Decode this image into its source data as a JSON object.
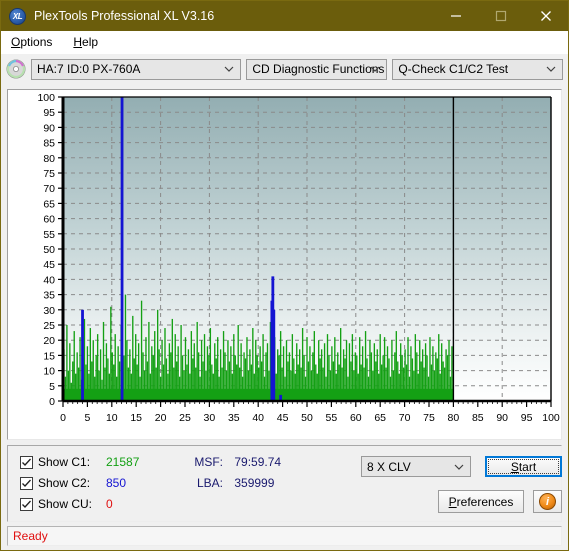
{
  "window": {
    "title": "PlexTools Professional XL V3.16",
    "app_icon": "XL",
    "minimize_label": "Minimize",
    "maximize_label": "Maximize",
    "close_label": "Close"
  },
  "menubar": {
    "items": [
      {
        "label": "Options",
        "accel": "O"
      },
      {
        "label": "Help",
        "accel": "H"
      }
    ]
  },
  "toolbar": {
    "drive_select": "HA:7 ID:0  PX-760A",
    "function_select": "CD Diagnostic Functions",
    "test_select": "Q-Check C1/C2 Test"
  },
  "controls": {
    "show_c1_label": "Show C1:",
    "show_c1_value": "21587",
    "show_c1_checked": true,
    "show_c2_label": "Show C2:",
    "show_c2_value": "850",
    "show_c2_checked": true,
    "show_cu_label": "Show CU:",
    "show_cu_value": "0",
    "show_cu_checked": true,
    "msf_label": "MSF:",
    "msf_value": "79:59.74",
    "lba_label": "LBA:",
    "lba_value": "359999",
    "speed_value": "8 X CLV",
    "start_label": "Start",
    "start_accel": "S",
    "preferences_label": "Preferences",
    "preferences_accel": "P",
    "info_label": "i"
  },
  "statusbar": {
    "text": "Ready"
  },
  "colors": {
    "titlebar": "#6b5d0c",
    "c1_green": "#14a014",
    "c2_blue": "#1414d2",
    "cu_red": "#e01010",
    "status_red": "#e01010",
    "stat_navy": "#1a1a6e",
    "accent_focus": "#0078d7"
  },
  "chart_data": {
    "type": "bar",
    "title": "",
    "xlabel": "",
    "ylabel": "",
    "xlim": [
      0,
      100
    ],
    "ylim": [
      0,
      100
    ],
    "xticks": [
      0,
      5,
      10,
      15,
      20,
      25,
      30,
      35,
      40,
      45,
      50,
      55,
      60,
      65,
      70,
      75,
      80,
      85,
      90,
      95,
      100
    ],
    "yticks": [
      0,
      5,
      10,
      15,
      20,
      25,
      30,
      35,
      40,
      45,
      50,
      55,
      60,
      65,
      70,
      75,
      80,
      85,
      90,
      95,
      100
    ],
    "grid": true,
    "legend": "none",
    "data_end_x": 80,
    "series": [
      {
        "name": "C1",
        "color": "#14a014",
        "x": [
          0.2,
          0.5,
          0.8,
          1.1,
          1.4,
          1.7,
          2.0,
          2.3,
          2.6,
          2.9,
          3.2,
          3.5,
          3.8,
          4.1,
          4.4,
          4.7,
          5.0,
          5.3,
          5.6,
          5.9,
          6.2,
          6.5,
          6.8,
          7.1,
          7.4,
          7.7,
          8.0,
          8.3,
          8.6,
          8.9,
          9.2,
          9.5,
          9.8,
          10.1,
          10.4,
          10.7,
          11.0,
          11.3,
          11.6,
          11.9,
          12.2,
          12.5,
          12.8,
          13.1,
          13.4,
          13.7,
          14.0,
          14.3,
          14.6,
          14.9,
          15.2,
          15.5,
          15.8,
          16.1,
          16.4,
          16.7,
          17.0,
          17.3,
          17.6,
          17.9,
          18.2,
          18.5,
          18.8,
          19.1,
          19.4,
          19.7,
          20.0,
          20.3,
          20.6,
          20.9,
          21.2,
          21.5,
          21.8,
          22.1,
          22.4,
          22.7,
          23.0,
          23.3,
          23.6,
          23.9,
          24.2,
          24.5,
          24.8,
          25.1,
          25.4,
          25.7,
          26.0,
          26.3,
          26.6,
          26.9,
          27.2,
          27.5,
          27.8,
          28.1,
          28.4,
          28.7,
          29.0,
          29.3,
          29.6,
          29.9,
          30.2,
          30.5,
          30.8,
          31.1,
          31.4,
          31.7,
          32.0,
          32.3,
          32.6,
          32.9,
          33.2,
          33.5,
          33.8,
          34.1,
          34.4,
          34.7,
          35.0,
          35.3,
          35.6,
          35.9,
          36.2,
          36.5,
          36.8,
          37.1,
          37.4,
          37.7,
          38.0,
          38.3,
          38.6,
          38.9,
          39.2,
          39.5,
          39.8,
          40.1,
          40.4,
          40.7,
          41.0,
          41.3,
          41.6,
          41.9,
          42.2,
          42.5,
          42.8,
          43.1,
          43.4,
          43.7,
          44.0,
          44.3,
          44.6,
          44.9,
          45.2,
          45.5,
          45.8,
          46.1,
          46.4,
          46.7,
          47.0,
          47.3,
          47.6,
          47.9,
          48.2,
          48.5,
          48.8,
          49.1,
          49.4,
          49.7,
          50.0,
          50.3,
          50.6,
          50.9,
          51.2,
          51.5,
          51.8,
          52.1,
          52.4,
          52.7,
          53.0,
          53.3,
          53.6,
          53.9,
          54.2,
          54.5,
          54.8,
          55.1,
          55.4,
          55.7,
          56.0,
          56.3,
          56.6,
          56.9,
          57.2,
          57.5,
          57.8,
          58.1,
          58.4,
          58.7,
          59.0,
          59.3,
          59.6,
          59.9,
          60.2,
          60.5,
          60.8,
          61.1,
          61.4,
          61.7,
          62.0,
          62.3,
          62.6,
          62.9,
          63.2,
          63.5,
          63.8,
          64.1,
          64.4,
          64.7,
          65.0,
          65.3,
          65.6,
          65.9,
          66.2,
          66.5,
          66.8,
          67.1,
          67.4,
          67.7,
          68.0,
          68.3,
          68.6,
          68.9,
          69.2,
          69.5,
          69.8,
          70.1,
          70.4,
          70.7,
          71.0,
          71.3,
          71.6,
          71.9,
          72.2,
          72.5,
          72.8,
          73.1,
          73.4,
          73.7,
          74.0,
          74.3,
          74.6,
          74.9,
          75.2,
          75.5,
          75.8,
          76.1,
          76.4,
          76.7,
          77.0,
          77.3,
          77.6,
          77.9,
          78.2,
          78.5,
          78.8,
          79.1,
          79.4,
          79.7
        ],
        "values": [
          17,
          8,
          25,
          10,
          19,
          6,
          13,
          23,
          9,
          16,
          11,
          21,
          7,
          14,
          27,
          12,
          18,
          9,
          24,
          13,
          20,
          8,
          15,
          22,
          10,
          17,
          7,
          26,
          11,
          19,
          14,
          9,
          31,
          16,
          12,
          22,
          8,
          18,
          13,
          25,
          10,
          15,
          35,
          20,
          11,
          17,
          9,
          28,
          14,
          22,
          12,
          19,
          8,
          33,
          16,
          10,
          21,
          13,
          26,
          9,
          18,
          15,
          23,
          11,
          30,
          17,
          8,
          20,
          12,
          24,
          14,
          9,
          19,
          16,
          27,
          11,
          22,
          13,
          18,
          8,
          25,
          15,
          10,
          21,
          12,
          17,
          9,
          23,
          14,
          19,
          11,
          26,
          16,
          8,
          20,
          13,
          22,
          10,
          18,
          15,
          24,
          12,
          9,
          19,
          14,
          21,
          8,
          17,
          11,
          23,
          16,
          10,
          20,
          13,
          18,
          9,
          22,
          15,
          12,
          25,
          11,
          19,
          8,
          16,
          14,
          21,
          10,
          17,
          12,
          24,
          9,
          20,
          15,
          11,
          18,
          13,
          22,
          8,
          16,
          19,
          10,
          26,
          14,
          12,
          21,
          9,
          17,
          15,
          23,
          11,
          18,
          8,
          20,
          13,
          16,
          10,
          22,
          14,
          9,
          19,
          12,
          17,
          11,
          24,
          15,
          8,
          21,
          13,
          18,
          10,
          16,
          23,
          12,
          9,
          20,
          14,
          17,
          11,
          19,
          8,
          22,
          15,
          10,
          18,
          13,
          21,
          9,
          16,
          12,
          24,
          11,
          17,
          14,
          20,
          8,
          19,
          13,
          22,
          10,
          16,
          15,
          9,
          21,
          12,
          18,
          11,
          23,
          14,
          8,
          20,
          16,
          10,
          19,
          13,
          17,
          9,
          22,
          12,
          15,
          21,
          11,
          18,
          14,
          8,
          20,
          10,
          16,
          23,
          13,
          9,
          19,
          15,
          11,
          17,
          12,
          21,
          8,
          18,
          14,
          10,
          22,
          16,
          9,
          20,
          13,
          17,
          11,
          19,
          15,
          8,
          21,
          12,
          18,
          10,
          16,
          14,
          22,
          9,
          19,
          13,
          11,
          17,
          15,
          20,
          8,
          18,
          12,
          16
        ]
      },
      {
        "name": "C2",
        "color": "#1414d2",
        "x": [
          4.0,
          12.1,
          42.8,
          43.0,
          43.2,
          44.6
        ],
        "values": [
          30,
          100,
          33,
          41,
          30,
          2
        ]
      }
    ]
  }
}
